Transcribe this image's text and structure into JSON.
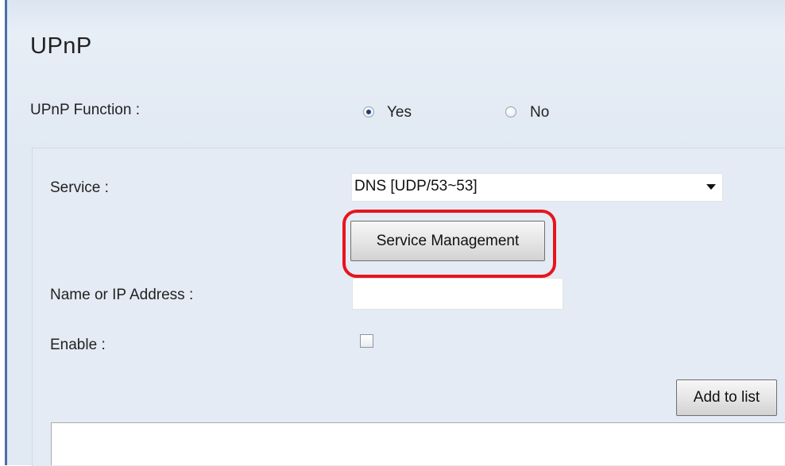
{
  "page": {
    "title": "UPnP"
  },
  "upnp_function": {
    "label": "UPnP Function :",
    "options": [
      {
        "label": "Yes",
        "selected": true
      },
      {
        "label": "No",
        "selected": false
      }
    ]
  },
  "service": {
    "label": "Service :",
    "selected_value": "DNS [UDP/53~53]"
  },
  "buttons": {
    "service_management": "Service Management",
    "add_to_list": "Add to list"
  },
  "name_or_ip": {
    "label": "Name or IP Address :",
    "value": ""
  },
  "enable": {
    "label": "Enable :",
    "checked": false
  },
  "highlight": {
    "color": "#e8141d",
    "target": "Service Management"
  },
  "colors": {
    "panel": "#dbe5f1",
    "inner_panel": "#e4ebf4",
    "accent": "#4a6fa8"
  }
}
